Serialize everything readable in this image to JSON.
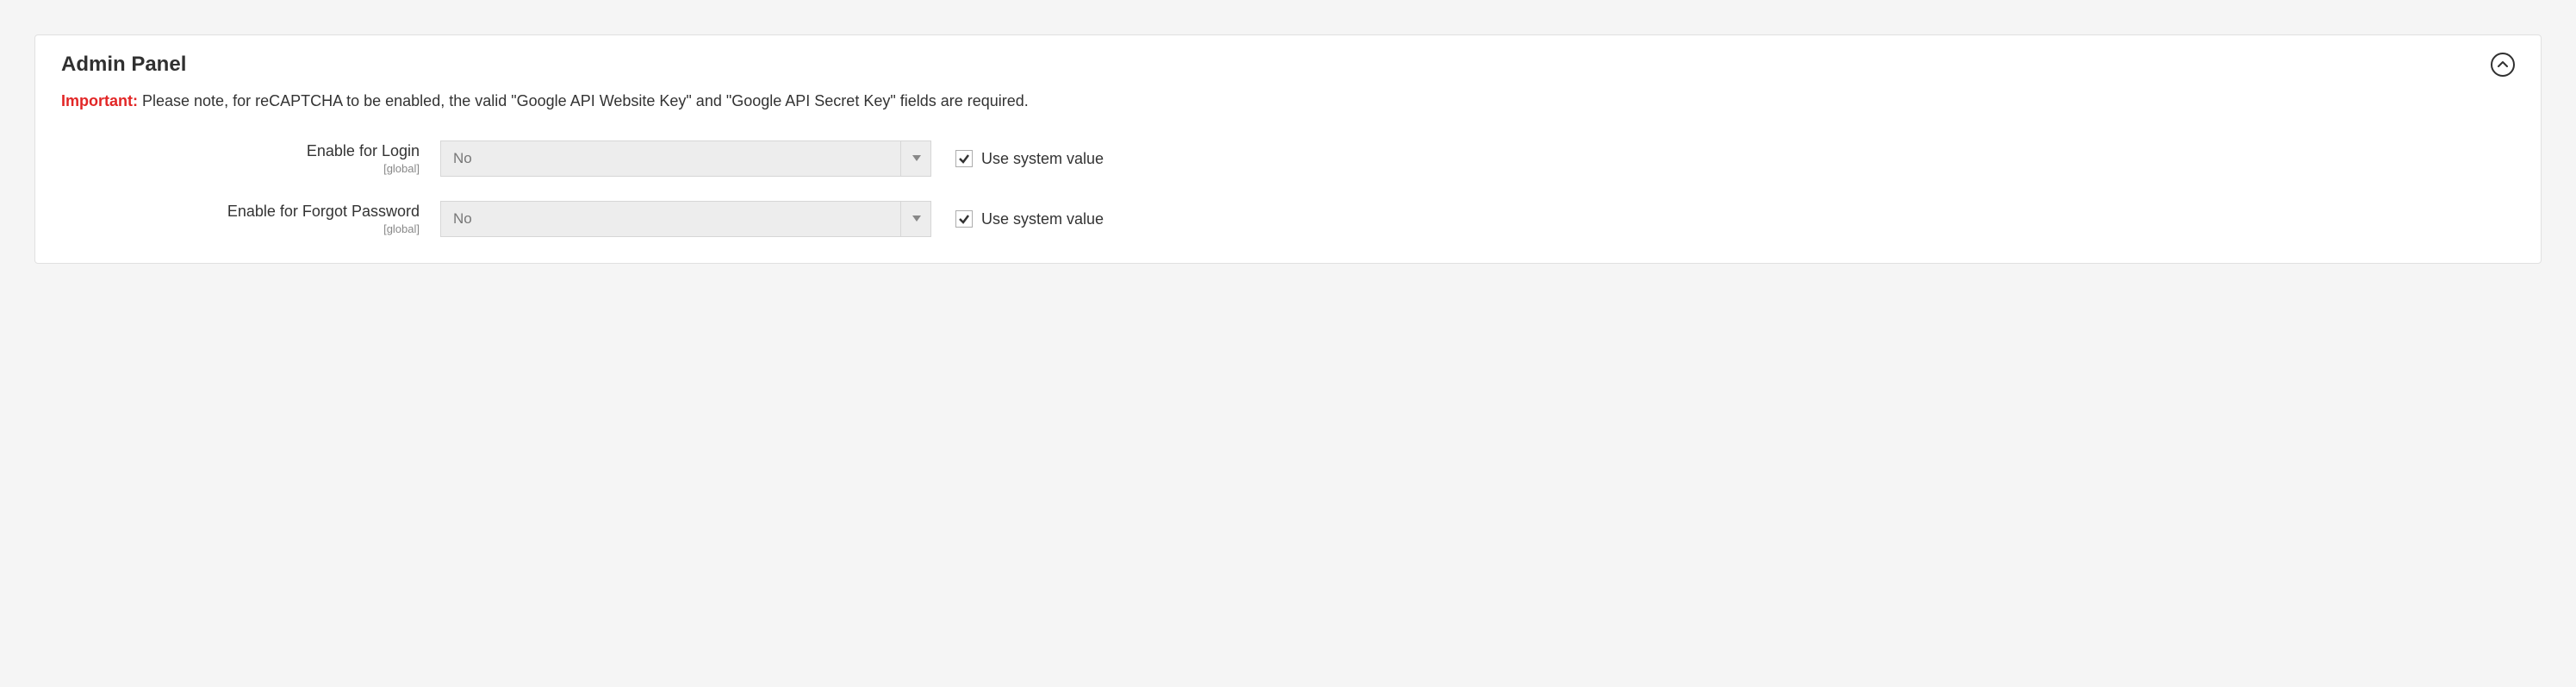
{
  "panel": {
    "title": "Admin Panel",
    "notice_prefix": "Important:",
    "notice_text": " Please note, for reCAPTCHA to be enabled, the valid \"Google API Website Key\" and \"Google API Secret Key\" fields are required."
  },
  "fields": {
    "login": {
      "label": "Enable for Login",
      "scope": "[global]",
      "value": "No",
      "use_system_label": "Use system value"
    },
    "forgot": {
      "label": "Enable for Forgot Password",
      "scope": "[global]",
      "value": "No",
      "use_system_label": "Use system value"
    }
  }
}
